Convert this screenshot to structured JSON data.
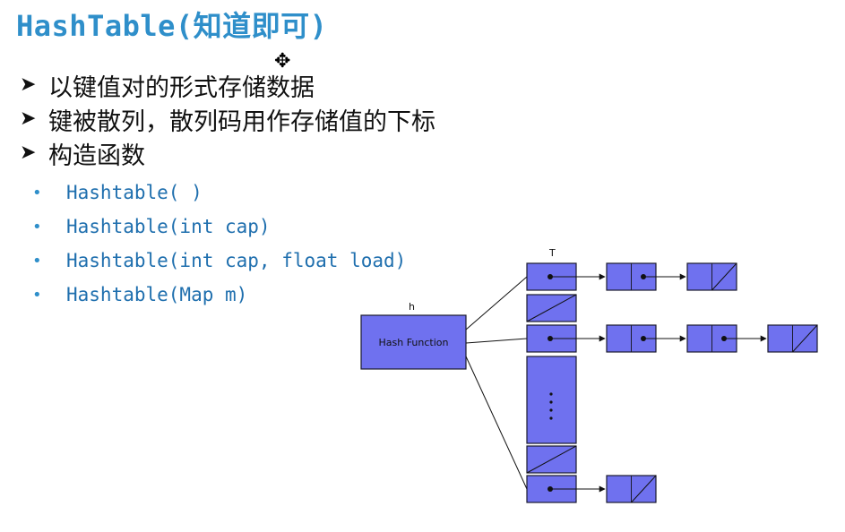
{
  "slide": {
    "title": "HashTable(知道即可)",
    "bullets": [
      "以键值对的形式存储数据",
      "键被散列，散列码用作存储值的下标",
      "构造函数"
    ],
    "constructors": [
      "Hashtable( )",
      "Hashtable(int cap)",
      "Hashtable(int cap, float load)",
      "Hashtable(Map m)"
    ]
  },
  "diagram": {
    "table_label": "T",
    "hash_label": "h",
    "hash_function": "Hash Function"
  },
  "colors": {
    "title": "#2f8fca",
    "box_fill": "#6f71ef",
    "box_stroke": "#1b1b2e",
    "code": "#1f6fae"
  },
  "icons": {
    "bullet": "arrow-bullet-icon",
    "sub_bullet": "dot-bullet-icon",
    "cursor": "move-cursor-icon"
  }
}
